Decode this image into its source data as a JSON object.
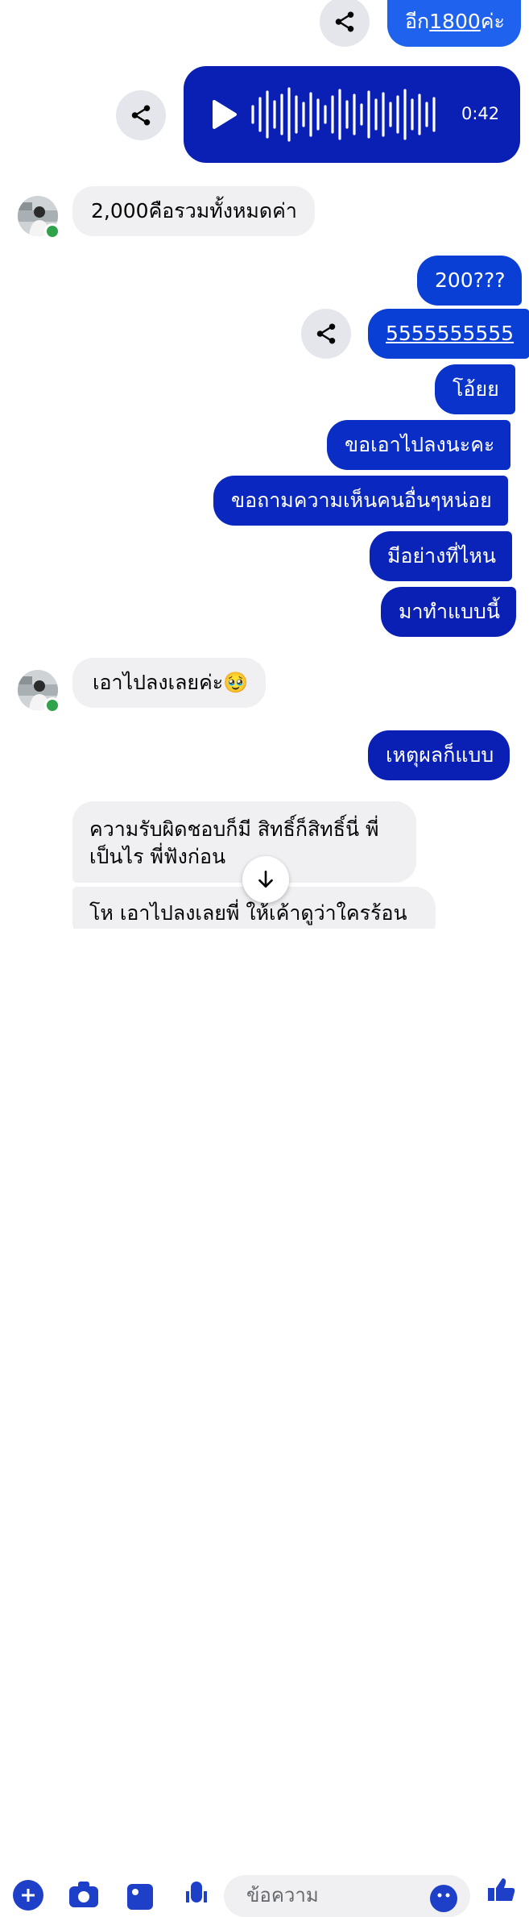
{
  "colors": {
    "outgoing_primary": "#0a3fd6",
    "outgoing_dark": "#0a1fb3",
    "outgoing_light": "#1e62ee",
    "incoming": "#f0f0f2",
    "online": "#31a24c",
    "accent": "#1e40c8"
  },
  "messages": {
    "m1_prefix": "อีก",
    "m1_number": "1800",
    "m1_suffix": "ค่ะ",
    "voice_duration": "0:42",
    "m3": "2,000คือรวมทั้งหมดค่า",
    "m4": "200???",
    "m5": "5555555555",
    "m6": "โอ้ยย",
    "m7": "ขอเอาไปลงนะคะ",
    "m8": "ขอถามความเห็นคนอื่นๆหน่อย",
    "m9": "มีอย่างที่ไหน",
    "m10": "มาทำแบบนี้",
    "m11": "เอาไปลงเลยค่ะ🥹",
    "m12": "เหตุผลก็แบบ",
    "m13_line1": "ความรับผิดชอบก็มี สิทธิ์ก็สิทธิ์นี่ พี่",
    "m13_line2": "เป็นไร พี่ฟังก่อน",
    "m14": "โห เอาไปลงเลยพี่ ให้เค้าดูว่าใครร้อน"
  },
  "composer": {
    "placeholder": "ข้อความ"
  },
  "icons": {
    "share": "share-icon",
    "play": "play-icon",
    "scroll_down": "arrow-down-icon",
    "plus": "plus-icon",
    "camera": "camera-icon",
    "gallery": "image-icon",
    "mic": "microphone-icon",
    "emoji": "emoji-icon",
    "like": "thumbs-up-icon"
  }
}
